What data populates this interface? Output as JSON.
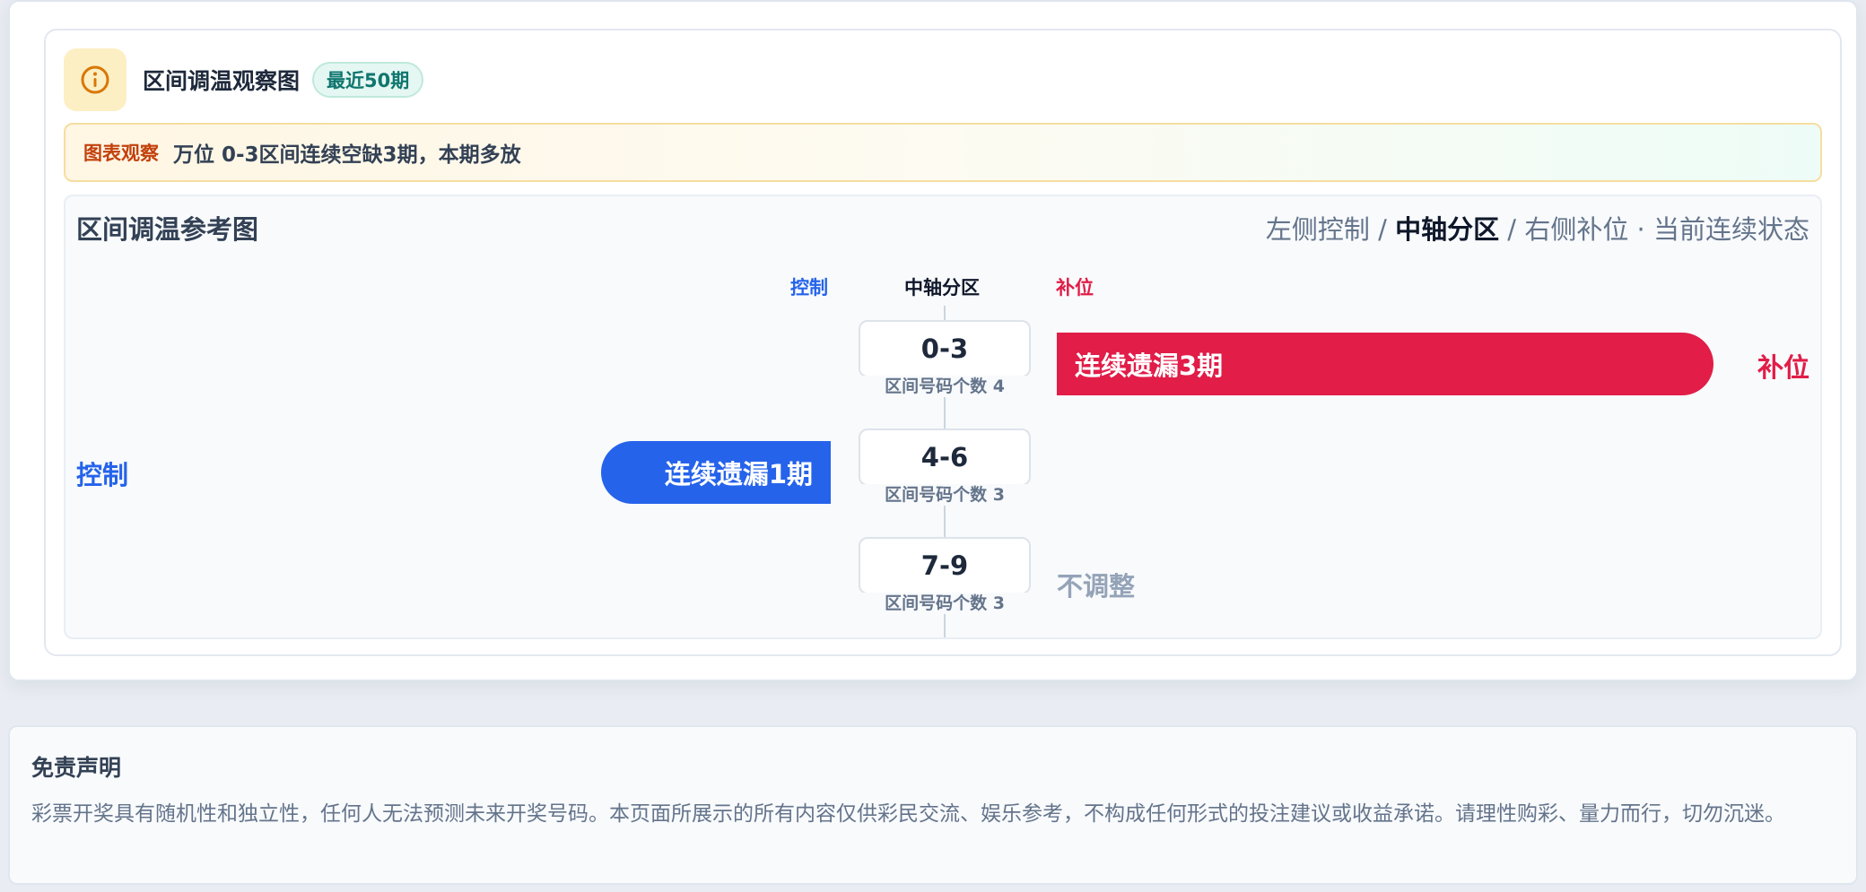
{
  "header": {
    "icon": "info-icon",
    "title": "区间调温观察图",
    "badge": "最近50期"
  },
  "observation": {
    "label": "图表观察",
    "text": "万位 0-3区间连续空缺3期，本期多放"
  },
  "reference": {
    "title": "区间调温参考图",
    "legend": {
      "left": "左侧控制",
      "sep1": " / ",
      "center": "中轴分区",
      "sep2": " / ",
      "right": "右侧补位",
      "dot": " · ",
      "state": "当前连续状态"
    },
    "columns": {
      "control": "控制",
      "axis": "中轴分区",
      "fill": "补位"
    },
    "zones": [
      {
        "range": "0-3",
        "count_label": "区间号码个数 4",
        "status": "连续遗漏3期",
        "side": "补位",
        "missed_periods": 3
      },
      {
        "range": "4-6",
        "count_label": "区间号码个数 3",
        "status": "连续遗漏1期",
        "side": "控制",
        "missed_periods": 1
      },
      {
        "range": "7-9",
        "count_label": "区间号码个数 3",
        "status": "不调整",
        "side": "",
        "missed_periods": 0
      }
    ]
  },
  "disclaimer": {
    "title": "免责声明",
    "text": "彩票开奖具有随机性和独立性，任何人无法预测未来开奖号码。本页面所展示的所有内容仅供彩民交流、娱乐参考，不构成任何形式的投注建议或收益承诺。请理性购彩、量力而行，切勿沉迷。"
  },
  "colors": {
    "control": "#2563eb",
    "fill": "#e11d48",
    "neutral": "#94a3b8",
    "badge": "#0f766e",
    "observe_label": "#c2410c"
  }
}
